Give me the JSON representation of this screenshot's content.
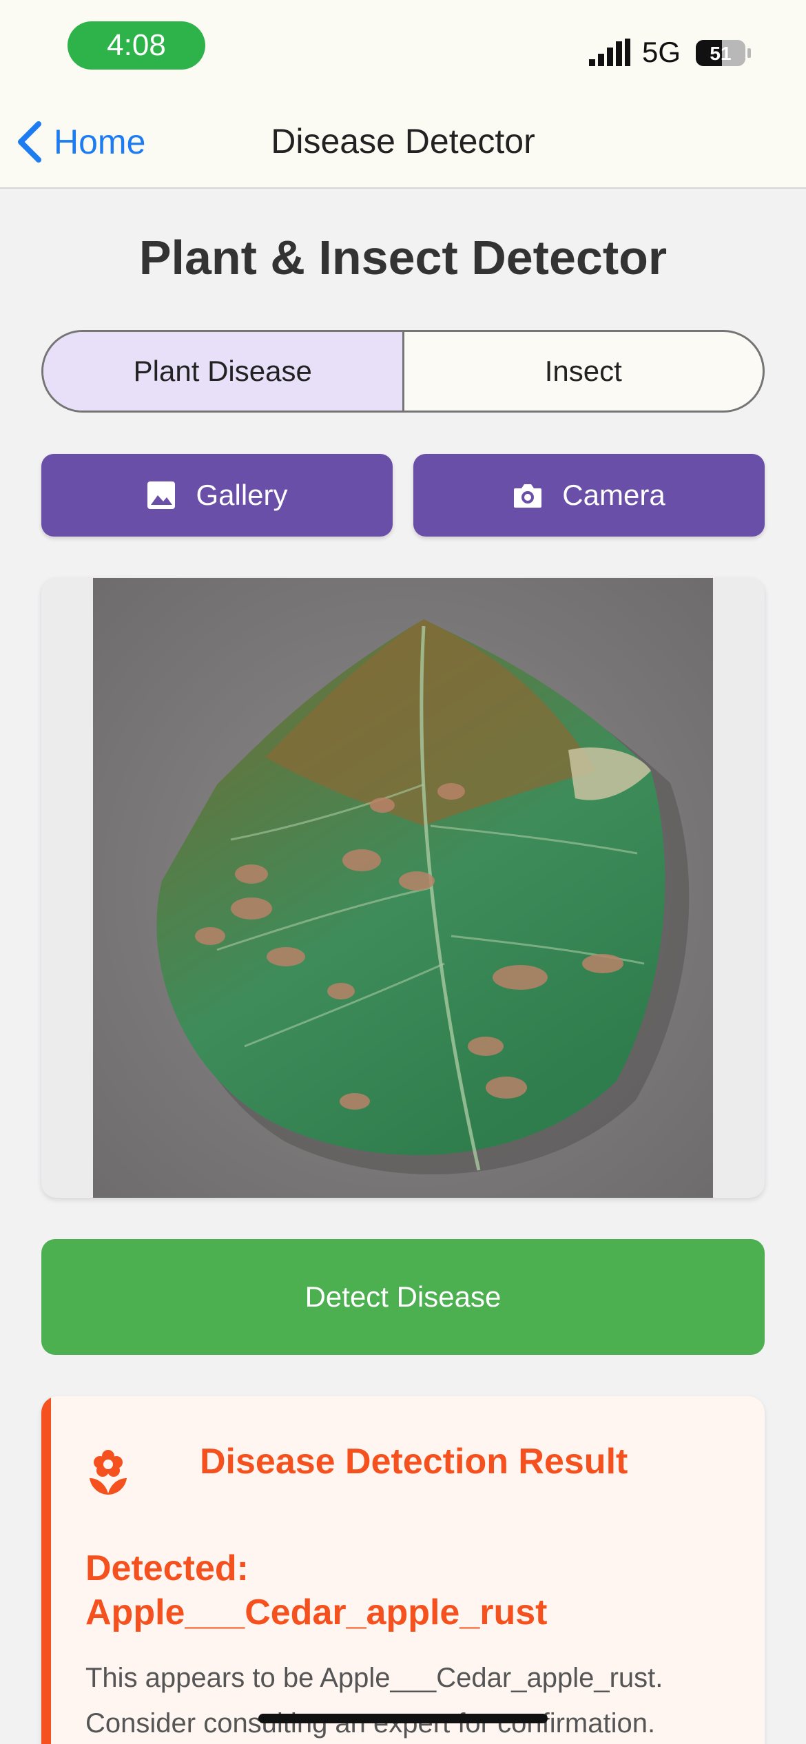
{
  "status_bar": {
    "time": "4:08",
    "network": "5G",
    "battery_level": "51"
  },
  "nav": {
    "back_label": "Home",
    "title": "Disease Detector"
  },
  "main": {
    "title": "Plant & Insect Detector",
    "segments": [
      {
        "label": "Plant Disease",
        "selected": true
      },
      {
        "label": "Insect",
        "selected": false
      }
    ],
    "gallery_label": "Gallery",
    "camera_label": "Camera",
    "detect_label": "Detect Disease"
  },
  "result": {
    "title": "Disease Detection Result",
    "detected_line1": "Detected:",
    "detected_line2": "Apple___Cedar_apple_rust",
    "description": "This appears to be Apple___Cedar_apple_rust. Consider consulting an expert for confirmation."
  },
  "colors": {
    "accent_purple": "#6a4fa8",
    "selected_segment": "#e8dff8",
    "detect_green": "#4caf50",
    "result_orange": "#f4511e",
    "time_pill_green": "#2eb34a",
    "link_blue": "#1d7cf2"
  },
  "icons": {
    "back": "chevron-left-icon",
    "gallery": "image-icon",
    "camera": "camera-icon",
    "result": "flower-icon"
  }
}
